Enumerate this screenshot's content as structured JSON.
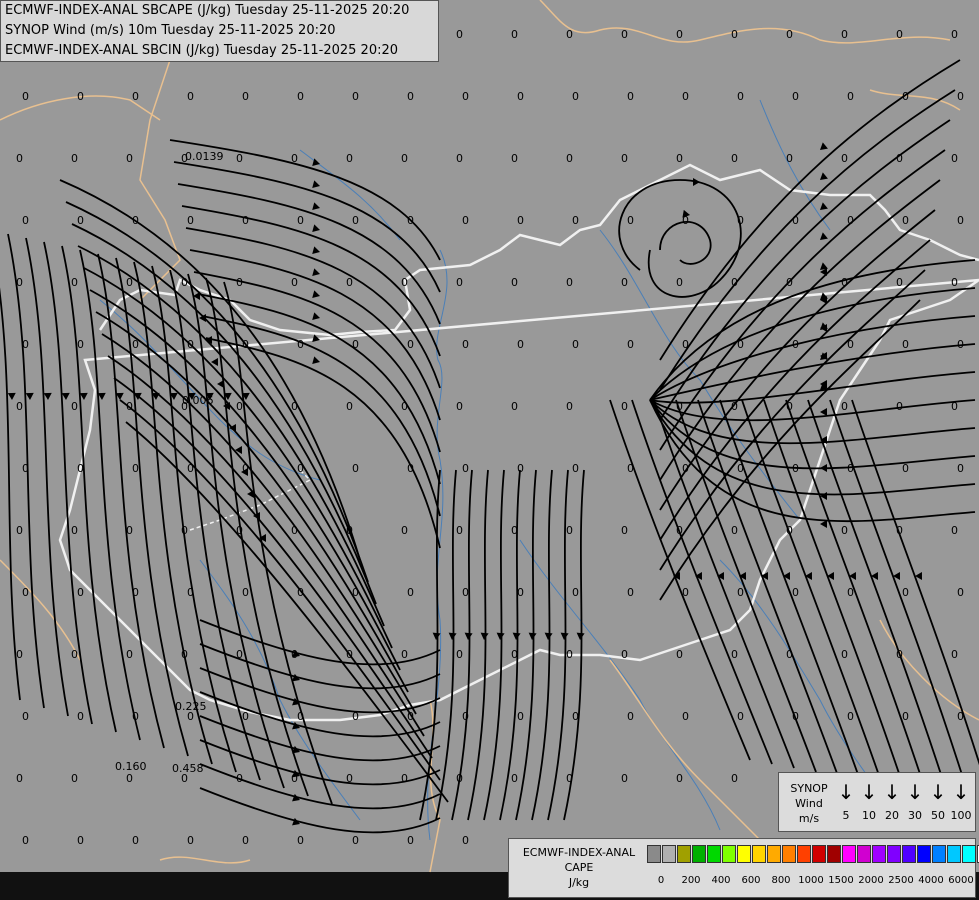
{
  "header": {
    "line1": "ECMWF-INDEX-ANAL SBCAPE (J/kg) Tuesday 25-11-2025 20:20",
    "line2": "SYNOP Wind (m/s) 10m Tuesday 25-11-2025 20:20",
    "line3": "ECMWF-INDEX-ANAL SBCIN (J/kg) Tuesday 25-11-2025 20:20"
  },
  "grid_value_default": "0",
  "grid_values_nonzero": [
    "0.0139",
    "0.006",
    "0.225",
    "0.160",
    "0.458"
  ],
  "wind_legend": {
    "title": [
      "SYNOP",
      "Wind",
      "m/s"
    ],
    "speeds": [
      "5",
      "10",
      "20",
      "30",
      "50",
      "100"
    ],
    "arrow_glyph": "↓"
  },
  "cape_legend": {
    "title": [
      "ECMWF-INDEX-ANAL",
      "CAPE",
      "J/kg"
    ],
    "colors": [
      "#8a8a8a",
      "#b0b0b0",
      "#a0a000",
      "#00b000",
      "#00d800",
      "#7fff00",
      "#ffff00",
      "#ffd400",
      "#ffaa00",
      "#ff7f00",
      "#ff4000",
      "#d00000",
      "#a00000",
      "#ff00ff",
      "#d000d0",
      "#a000ff",
      "#8000ff",
      "#5000ff",
      "#0000ff",
      "#0080ff",
      "#00c8ff",
      "#00ffff",
      "#ffffff"
    ],
    "labels": [
      "0",
      "200",
      "400",
      "600",
      "800",
      "1000",
      "1500",
      "2000",
      "2500",
      "4000",
      "6000"
    ]
  },
  "colors": {
    "background": "#999999",
    "country_border": "#f0f0f0",
    "region_border": "#e8c090",
    "rivers": "#4a7fb8",
    "streamlines": "#000000"
  }
}
